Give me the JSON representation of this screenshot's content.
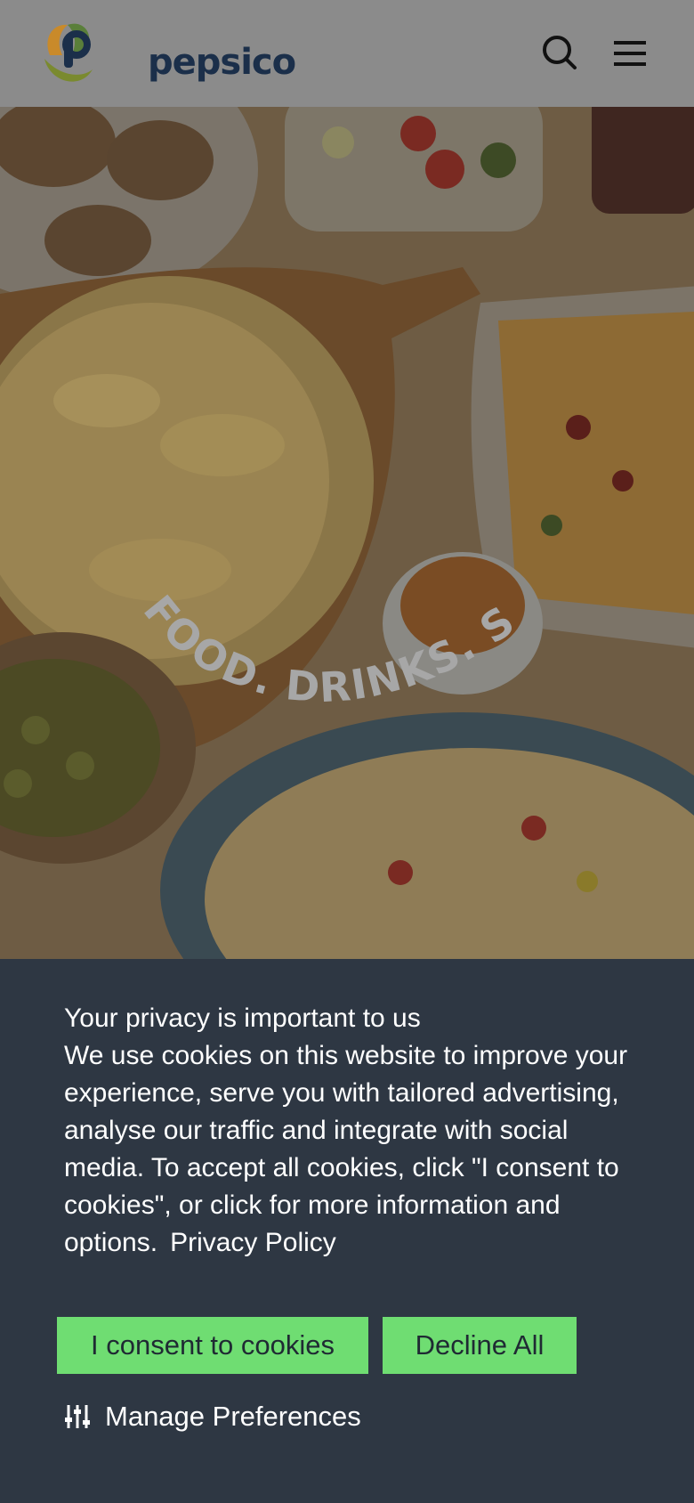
{
  "header": {
    "logo_text": "pepsico",
    "search_icon": "search-icon",
    "menu_icon": "hamburger-menu-icon"
  },
  "hero": {
    "tagline": "FOOD. DRINKS. SMILES."
  },
  "cookie_banner": {
    "title": "Your privacy is important to us",
    "body": "We use cookies on this website to improve your experience, serve you with tailored advertising, analyse our traffic and integrate with social media. To accept all cookies, click \"I consent to cookies\", or click for more information and options.",
    "privacy_link": "Privacy Policy",
    "consent_button": "I consent to cookies",
    "decline_button": "Decline All",
    "manage_preferences": "Manage Preferences",
    "manage_icon": "sliders-icon"
  },
  "colors": {
    "header_bg": "#8b8b8b",
    "banner_bg": "#2e3743",
    "button_green": "#6fdd72",
    "logo_navy": "#1b2f4a"
  }
}
